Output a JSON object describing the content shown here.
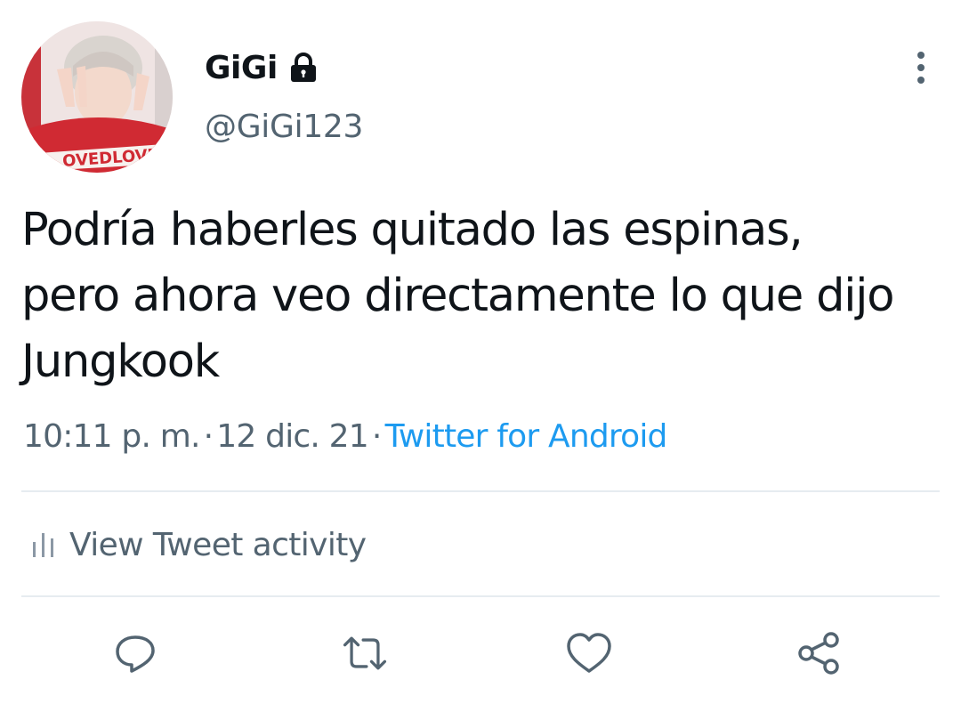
{
  "author": {
    "display_name": "GiGi",
    "handle": "@GiGi123",
    "avatar_icon": "profile-photo",
    "avatar_caption": "OVEDLOVE",
    "protected_icon": "lock-icon"
  },
  "more_icon": "more-vertical-icon",
  "tweet": {
    "text": "Podría haberles quitado las espinas,\npero ahora veo directamente lo que dijo\nJungkook",
    "time": "10:11 p. m.",
    "date": "12 dic. 21",
    "separator": "·",
    "source": "Twitter for Android"
  },
  "activity": {
    "label": "View Tweet activity",
    "icon": "bar-chart-icon"
  },
  "actions": [
    {
      "icon": "reply-icon"
    },
    {
      "icon": "retweet-icon"
    },
    {
      "icon": "like-icon"
    },
    {
      "icon": "share-icon"
    }
  ],
  "colors": {
    "text_primary": "#0f1419",
    "text_secondary": "#536471",
    "link": "#1d9bf0",
    "divider": "#e6ecf0",
    "icon": "#536471"
  }
}
